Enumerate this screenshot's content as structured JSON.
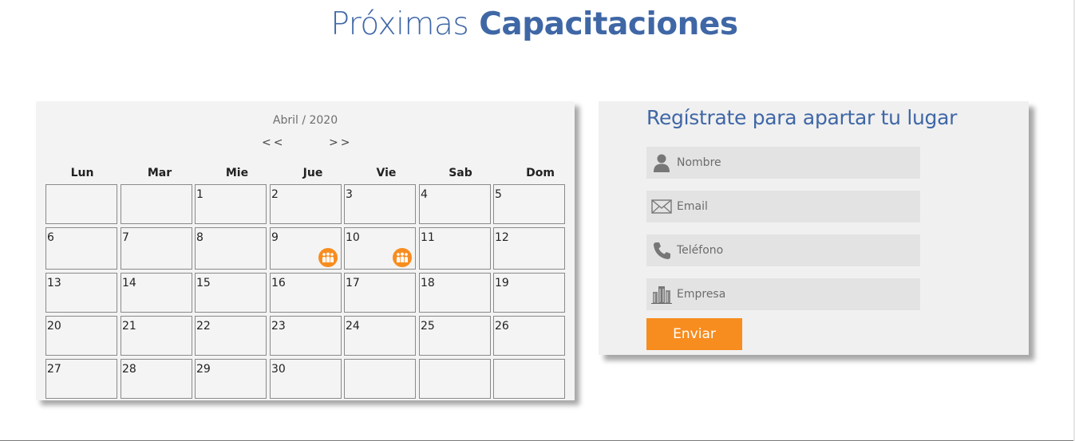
{
  "header": {
    "title_light": "Próximas",
    "title_bold": "Capacitaciones"
  },
  "calendar": {
    "month_label": "Abril / 2020",
    "prev_label": "<<",
    "next_label": ">>",
    "weekdays": [
      "Lun",
      "Mar",
      "Mie",
      "Jue",
      "Vie",
      "Sab",
      "Dom"
    ],
    "days": [
      "",
      "",
      "1",
      "2",
      "3",
      "4",
      "5",
      "6",
      "7",
      "8",
      "9",
      "10",
      "11",
      "12",
      "13",
      "14",
      "15",
      "16",
      "17",
      "18",
      "19",
      "20",
      "21",
      "22",
      "23",
      "24",
      "25",
      "26",
      "27",
      "28",
      "29",
      "30",
      "",
      "",
      ""
    ],
    "event_days": [
      "9",
      "10"
    ],
    "event_icon": "training-group-icon",
    "event_color": "#f78d1f"
  },
  "form": {
    "title": "Regístrate para apartar tu lugar",
    "fields": [
      {
        "placeholder": "Nombre",
        "value": "",
        "icon": "user-icon"
      },
      {
        "placeholder": "Email",
        "value": "",
        "icon": "envelope-icon"
      },
      {
        "placeholder": "Teléfono",
        "value": "",
        "icon": "phone-icon"
      },
      {
        "placeholder": "Empresa",
        "value": "",
        "icon": "building-icon"
      }
    ],
    "submit_label": "Enviar"
  },
  "colors": {
    "title_blue": "#3f67a6",
    "accent_orange": "#f78d1f",
    "panel_bg": "#f3f3f3"
  }
}
